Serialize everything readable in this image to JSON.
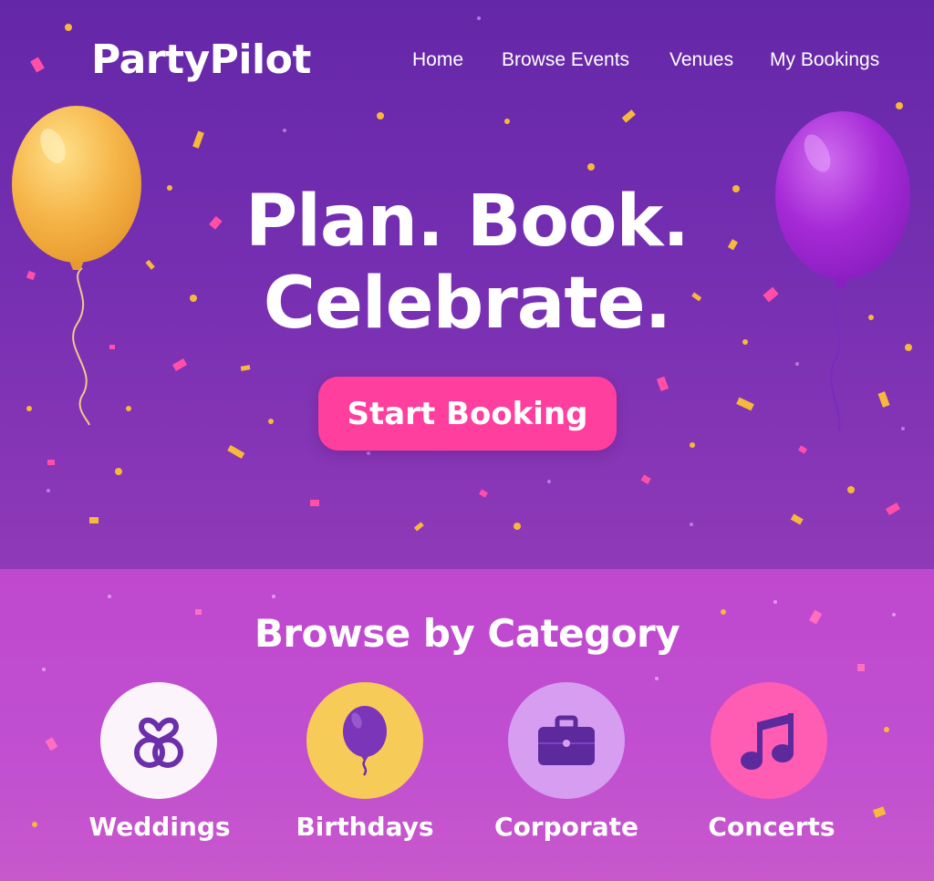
{
  "app": {
    "name": "PartyPilot"
  },
  "nav": {
    "items": [
      {
        "label": "Home"
      },
      {
        "label": "Browse Events"
      },
      {
        "label": "Venues"
      },
      {
        "label": "My Bookings"
      }
    ]
  },
  "hero": {
    "headline_line1": "Plan. Book.",
    "headline_line2": "Celebrate.",
    "cta_label": "Start Booking"
  },
  "categories": {
    "title": "Browse by Category",
    "items": [
      {
        "label": "Weddings",
        "icon": "wedding-rings-icon",
        "circle_color": "#fbf4fb"
      },
      {
        "label": "Birthdays",
        "icon": "balloon-icon",
        "circle_color": "#f7cb58"
      },
      {
        "label": "Corporate",
        "icon": "briefcase-icon",
        "circle_color": "#d79df0"
      },
      {
        "label": "Concerts",
        "icon": "music-note-icon",
        "circle_color": "#ff5cb4"
      }
    ]
  },
  "colors": {
    "hero_top": "#6427a8",
    "hero_bottom": "#8f3ab8",
    "section_bg": "#c14fd0",
    "cta": "#ff3f9d",
    "icon_purple": "#6b2fa9",
    "balloon_left": "#f6b64a",
    "balloon_right": "#a62ad6",
    "confetti_yellow": "#f6b93b",
    "confetti_pink": "#ff4fa8"
  }
}
